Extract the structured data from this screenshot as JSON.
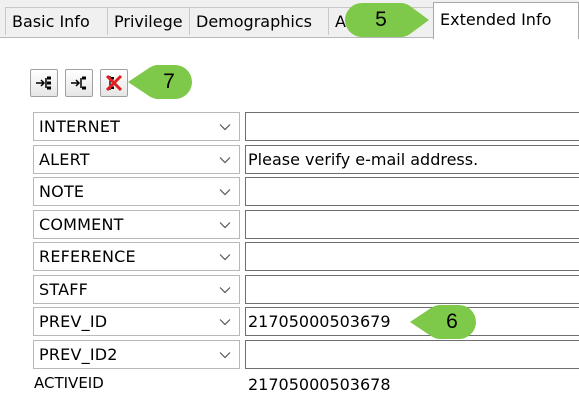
{
  "tabs": [
    {
      "label": "Basic Info",
      "active": false
    },
    {
      "label": "Privilege",
      "active": false
    },
    {
      "label": "Demographics",
      "active": false
    },
    {
      "label": "Addresses",
      "active": false
    },
    {
      "label": "Extended Info",
      "active": true
    }
  ],
  "toolbar": {
    "buttons": [
      {
        "icon": "expand-tree-icon"
      },
      {
        "icon": "collapse-tree-icon"
      },
      {
        "icon": "delete-icon"
      }
    ]
  },
  "callouts": {
    "tab_marker": "5",
    "field_marker": "6",
    "toolbar_marker": "7"
  },
  "fields": [
    {
      "type": "INTERNET",
      "value": ""
    },
    {
      "type": "ALERT",
      "value": "Please verify e-mail address."
    },
    {
      "type": "NOTE",
      "value": ""
    },
    {
      "type": "COMMENT",
      "value": ""
    },
    {
      "type": "REFERENCE",
      "value": ""
    },
    {
      "type": "STAFF",
      "value": ""
    },
    {
      "type": "PREV_ID",
      "value": "21705000503679"
    },
    {
      "type": "PREV_ID2",
      "value": ""
    }
  ],
  "active_id": {
    "label": "ACTIVEID",
    "value": "21705000503678"
  },
  "colors": {
    "callout_green": "#7ec94a",
    "delete_red": "#e02020",
    "tab_background": "#f0f0f0"
  }
}
